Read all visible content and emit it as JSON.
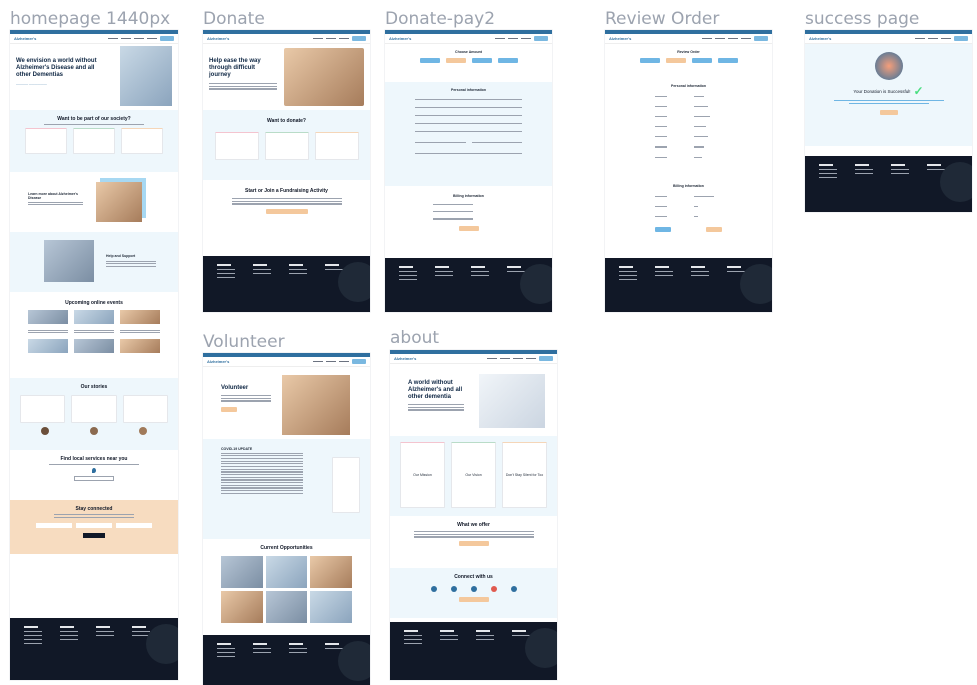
{
  "frames": {
    "homepage": {
      "label": "homepage 1440px",
      "logo": "Alzheimer's",
      "hero_title": "We envision a world without Alzheimer's Disease and all other Dementias",
      "part_title": "Want to be part of our society?",
      "learn_title": "Learn more about Alzheimer's Disease",
      "help_title": "Help and Support",
      "events_title": "Upcoming online events",
      "stories_title": "Our stories",
      "services_title": "Find local services near you",
      "connected_title": "Stay connected"
    },
    "donate": {
      "label": "Donate",
      "hero_title": "Help ease the way through difficult journey",
      "want_title": "Want to donate?",
      "fundraise_title": "Start or Join a Fundraising Activity"
    },
    "donate_pay": {
      "label": "Donate-pay2",
      "choose_title": "Choose Amount",
      "personal_title": "Personal information",
      "billing_title": "Billing information"
    },
    "review": {
      "label": "Review Order",
      "title": "Review Order",
      "personal_title": "Personal information",
      "billing_title": "Billing information"
    },
    "success": {
      "label": "success page",
      "message": "Your Donation is Successful!"
    },
    "volunteer": {
      "label": "Volunteer",
      "hero_title": "Volunteer",
      "covid_title": "COVID-19 UPDATE",
      "opportunities_title": "Current Opportunities"
    },
    "about": {
      "label": "about",
      "hero_title": "A world without Alzheimer's and all other dementia",
      "mission": "Our Mission",
      "vision": "Our Vision",
      "tagline": "Don't Stay Silent for Too",
      "offer_title": "What we offer",
      "connect_title": "Connect with us"
    }
  },
  "colors": {
    "brand": "#2f6f9f",
    "accent_blue": "#6fb6e4",
    "peach": "#f4c89c",
    "footer": "#111827",
    "success": "#4ade80"
  }
}
